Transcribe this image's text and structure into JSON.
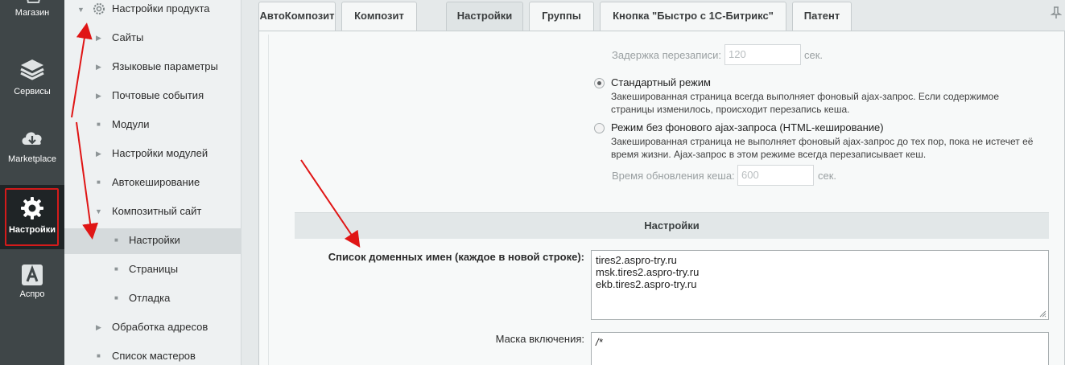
{
  "iconbar": {
    "items": [
      {
        "label": "Магазин",
        "icon": "cart-icon"
      },
      {
        "label": "Сервисы",
        "icon": "layers-icon"
      },
      {
        "label": "Marketplace",
        "icon": "cloud-download-icon"
      },
      {
        "label": "Настройки",
        "icon": "gear-icon",
        "active": true
      },
      {
        "label": "Аспро",
        "icon": "letter-a-icon"
      }
    ]
  },
  "tree": {
    "root": "Настройки продукта",
    "items": [
      {
        "label": "Сайты",
        "type": "expandable"
      },
      {
        "label": "Языковые параметры",
        "type": "expandable"
      },
      {
        "label": "Почтовые события",
        "type": "expandable"
      },
      {
        "label": "Модули",
        "type": "leaf"
      },
      {
        "label": "Настройки модулей",
        "type": "expandable"
      },
      {
        "label": "Автокеширование",
        "type": "leaf"
      },
      {
        "label": "Композитный сайт",
        "type": "expanded"
      },
      {
        "label": "Настройки",
        "type": "child",
        "selected": true
      },
      {
        "label": "Страницы",
        "type": "child"
      },
      {
        "label": "Отладка",
        "type": "child"
      },
      {
        "label": "Обработка адресов",
        "type": "expandable"
      },
      {
        "label": "Список мастеров",
        "type": "leaf"
      }
    ]
  },
  "tabs": [
    {
      "label": "АвтоКомпозит"
    },
    {
      "label": "Композит"
    },
    {
      "label": "Настройки",
      "active": true
    },
    {
      "label": "Группы"
    },
    {
      "label": "Кнопка \"Быстро с 1С-Битрикс\""
    },
    {
      "label": "Патент"
    }
  ],
  "form": {
    "rewrite_delay": {
      "label": "Задержка перезаписи:",
      "value": "120",
      "unit": "сек."
    },
    "mode_standard": {
      "title": "Стандартный режим",
      "desc_line1": "Закешированная страница всегда выполняет фоновый ajax-запрос. Если содержимое",
      "desc_line2": "страницы изменилось, происходит перезапись кеша.",
      "checked": true
    },
    "mode_html": {
      "title": "Режим без фонового ajax-запроса (HTML-кеширование)",
      "desc_line1": "Закешированная страница не выполняет фоновый ajax-запрос до тех пор, пока не истечет её",
      "desc_line2": "время жизни. Ajax-запрос в этом режиме всегда перезаписывает кеш.",
      "checked": false
    },
    "cache_refresh": {
      "label": "Время обновления кеша:",
      "value": "600",
      "unit": "сек."
    },
    "section_title": "Настройки",
    "domains": {
      "label": "Список доменных имен (каждое в новой строке):",
      "lines": [
        "tires2.aspro-try.ru",
        "msk.tires2.aspro-try.ru",
        "ekb.tires2.aspro-try.ru"
      ]
    },
    "include_mask": {
      "label": "Маска включения:",
      "value": "/*"
    }
  },
  "colors": {
    "iconbar_bg": "#3f4648",
    "active_frame": "#d41b1b",
    "arrow": "#e01515"
  }
}
